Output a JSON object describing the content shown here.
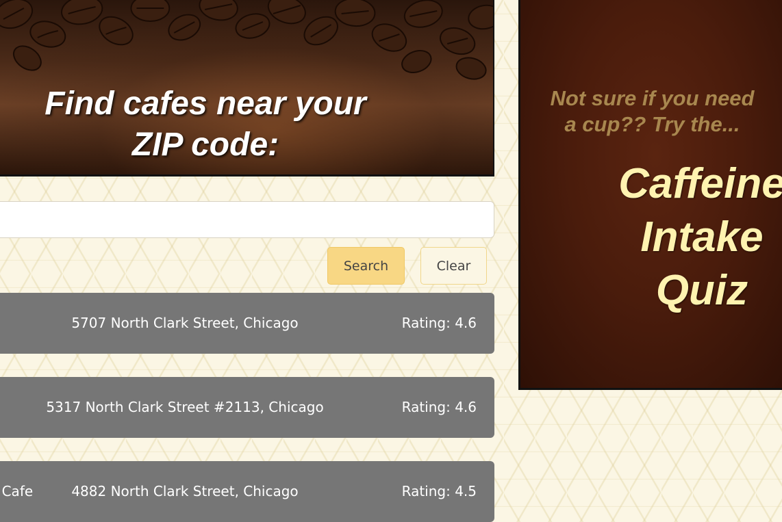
{
  "hero": {
    "title_line1": "Find cafes near your",
    "title_line2": "ZIP code:"
  },
  "search": {
    "zip_value": "",
    "zip_placeholder": "",
    "search_label": "Search",
    "clear_label": "Clear"
  },
  "results": [
    {
      "name": "",
      "address": "5707 North Clark Street, Chicago",
      "rating": "Rating: 4.6"
    },
    {
      "name": "",
      "address": "5317 North Clark Street #2113, Chicago",
      "rating": "Rating: 4.6"
    },
    {
      "name": "o Cafe",
      "address": "4882 North Clark Street, Chicago",
      "rating": "Rating: 4.5"
    }
  ],
  "quiz": {
    "teaser_line1": "Not sure if you need",
    "teaser_line2": "a cup?? Try the...",
    "title_line1": "Caffeine",
    "title_line2": "Intake",
    "title_line3": "Quiz"
  },
  "colors": {
    "page_background": "#fbf6e4",
    "search_button": "#f8d784",
    "result_card": "#767676",
    "quiz_background": "#4a1c0c",
    "quiz_title": "#fff3b0",
    "quiz_teaser": "#a8874f"
  },
  "icons": {
    "hero_image": "coffee-beans-image"
  }
}
